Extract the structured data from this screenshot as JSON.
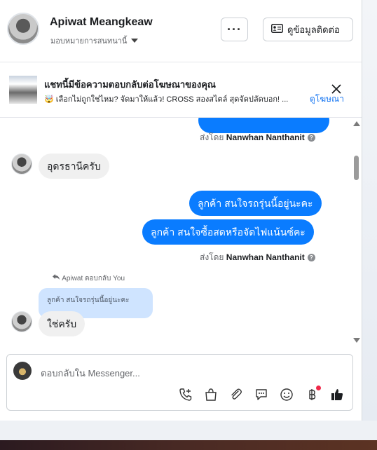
{
  "header": {
    "contact_name": "Apiwat Meangkeaw",
    "assign_label": "มอบหมายการสนทนานี้",
    "more_label": "···",
    "contact_info_label": "ดูข้อมูลติดต่อ"
  },
  "ad_banner": {
    "title": "แชทนี้มีข้อความตอบกลับต่อโฆษณาของคุณ",
    "description": "🤯 เลือกไม่ถูกใช่ไหม? จัดมาให้แล้ว! CROSS สองสไตล์ สุดจัดปลัดบอก! ...",
    "link_label": "ดูโฆษณา"
  },
  "messages": {
    "sent_by_prefix": "ส่งโดย",
    "sent_by_name_1": "Nanwhan Nanthanit",
    "in_1": "อุดรธานีครับ",
    "out_1": "ลูกค้า  สนใจรถรุ่นนี้อยู่นะคะ",
    "out_2": "ลูกค้า  สนใจซื้อสดหรือจัดไฟแน้นซ์คะ",
    "sent_by_name_2": "Nanwhan Nanthanit",
    "reply_note": "Apiwat ตอบกลับ You",
    "quoted_text": "ลูกค้า สนใจรถรุ่นนี้อยู่นะคะ",
    "in_2": "ใช่ครับ"
  },
  "composer": {
    "placeholder": "ตอบกลับใน Messenger..."
  },
  "colors": {
    "accent": "#0a7cff",
    "link": "#1877f2",
    "quoted_bg": "#cfe4ff",
    "incoming_bg": "#f0f0f0",
    "notification_dot": "#f02849"
  },
  "icons": {
    "composer_tools": [
      "phone-plus-icon",
      "shopping-bag-icon",
      "paperclip-icon",
      "chat-bubble-icon",
      "emoji-icon",
      "baht-icon",
      "thumbs-up-icon"
    ]
  }
}
